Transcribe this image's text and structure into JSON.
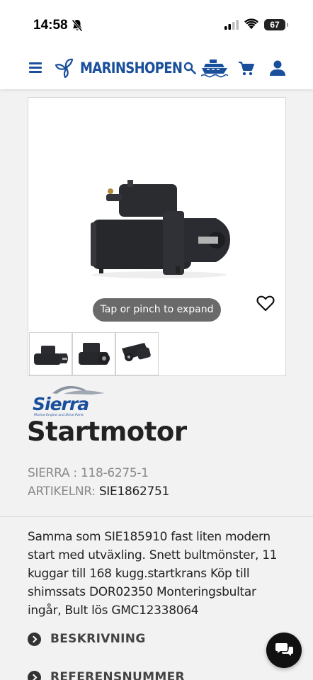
{
  "status_bar": {
    "time": "14:58",
    "battery": "67"
  },
  "header": {
    "logo_text": "MARINSHOPEN",
    "icons": [
      "menu-icon",
      "propeller-logo-icon",
      "search-icon",
      "boat-icon",
      "cart-icon",
      "user-icon"
    ]
  },
  "gallery": {
    "expand_hint": "Tap or pinch to expand",
    "thumbnails": [
      "starter-front",
      "starter-side",
      "starter-angle"
    ]
  },
  "brand": {
    "name": "Sierra",
    "tagline": "Marine Engine and Drive Parts"
  },
  "product": {
    "title": "Startmotor",
    "sierra_label": "SIERRA : 118-6275-1",
    "article_label": "ARTIKELNR:",
    "article_number": "SIE1862751",
    "description": "Samma som SIE185910 fast liten modern start med utväxling. Snett bultmönster, 11 kuggar till 168 kugg.startkrans Köp till shimssats DOR02350 Monteringsbultar ingår, Bult lös GMC12338064"
  },
  "sections": [
    {
      "label": "BESKRIVNING"
    },
    {
      "label": "REFERENSNUMMER"
    }
  ],
  "colors": {
    "brand_blue": "#1a4f9c",
    "pill_gray": "#6a6a6a",
    "chat_black": "#111111"
  }
}
